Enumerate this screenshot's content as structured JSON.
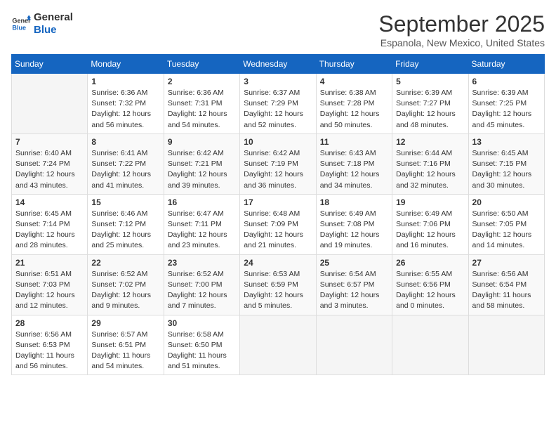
{
  "logo": {
    "line1": "General",
    "line2": "Blue"
  },
  "title": "September 2025",
  "location": "Espanola, New Mexico, United States",
  "days_header": [
    "Sunday",
    "Monday",
    "Tuesday",
    "Wednesday",
    "Thursday",
    "Friday",
    "Saturday"
  ],
  "weeks": [
    [
      {
        "day": "",
        "info": ""
      },
      {
        "day": "1",
        "info": "Sunrise: 6:36 AM\nSunset: 7:32 PM\nDaylight: 12 hours\nand 56 minutes."
      },
      {
        "day": "2",
        "info": "Sunrise: 6:36 AM\nSunset: 7:31 PM\nDaylight: 12 hours\nand 54 minutes."
      },
      {
        "day": "3",
        "info": "Sunrise: 6:37 AM\nSunset: 7:29 PM\nDaylight: 12 hours\nand 52 minutes."
      },
      {
        "day": "4",
        "info": "Sunrise: 6:38 AM\nSunset: 7:28 PM\nDaylight: 12 hours\nand 50 minutes."
      },
      {
        "day": "5",
        "info": "Sunrise: 6:39 AM\nSunset: 7:27 PM\nDaylight: 12 hours\nand 48 minutes."
      },
      {
        "day": "6",
        "info": "Sunrise: 6:39 AM\nSunset: 7:25 PM\nDaylight: 12 hours\nand 45 minutes."
      }
    ],
    [
      {
        "day": "7",
        "info": "Sunrise: 6:40 AM\nSunset: 7:24 PM\nDaylight: 12 hours\nand 43 minutes."
      },
      {
        "day": "8",
        "info": "Sunrise: 6:41 AM\nSunset: 7:22 PM\nDaylight: 12 hours\nand 41 minutes."
      },
      {
        "day": "9",
        "info": "Sunrise: 6:42 AM\nSunset: 7:21 PM\nDaylight: 12 hours\nand 39 minutes."
      },
      {
        "day": "10",
        "info": "Sunrise: 6:42 AM\nSunset: 7:19 PM\nDaylight: 12 hours\nand 36 minutes."
      },
      {
        "day": "11",
        "info": "Sunrise: 6:43 AM\nSunset: 7:18 PM\nDaylight: 12 hours\nand 34 minutes."
      },
      {
        "day": "12",
        "info": "Sunrise: 6:44 AM\nSunset: 7:16 PM\nDaylight: 12 hours\nand 32 minutes."
      },
      {
        "day": "13",
        "info": "Sunrise: 6:45 AM\nSunset: 7:15 PM\nDaylight: 12 hours\nand 30 minutes."
      }
    ],
    [
      {
        "day": "14",
        "info": "Sunrise: 6:45 AM\nSunset: 7:14 PM\nDaylight: 12 hours\nand 28 minutes."
      },
      {
        "day": "15",
        "info": "Sunrise: 6:46 AM\nSunset: 7:12 PM\nDaylight: 12 hours\nand 25 minutes."
      },
      {
        "day": "16",
        "info": "Sunrise: 6:47 AM\nSunset: 7:11 PM\nDaylight: 12 hours\nand 23 minutes."
      },
      {
        "day": "17",
        "info": "Sunrise: 6:48 AM\nSunset: 7:09 PM\nDaylight: 12 hours\nand 21 minutes."
      },
      {
        "day": "18",
        "info": "Sunrise: 6:49 AM\nSunset: 7:08 PM\nDaylight: 12 hours\nand 19 minutes."
      },
      {
        "day": "19",
        "info": "Sunrise: 6:49 AM\nSunset: 7:06 PM\nDaylight: 12 hours\nand 16 minutes."
      },
      {
        "day": "20",
        "info": "Sunrise: 6:50 AM\nSunset: 7:05 PM\nDaylight: 12 hours\nand 14 minutes."
      }
    ],
    [
      {
        "day": "21",
        "info": "Sunrise: 6:51 AM\nSunset: 7:03 PM\nDaylight: 12 hours\nand 12 minutes."
      },
      {
        "day": "22",
        "info": "Sunrise: 6:52 AM\nSunset: 7:02 PM\nDaylight: 12 hours\nand 9 minutes."
      },
      {
        "day": "23",
        "info": "Sunrise: 6:52 AM\nSunset: 7:00 PM\nDaylight: 12 hours\nand 7 minutes."
      },
      {
        "day": "24",
        "info": "Sunrise: 6:53 AM\nSunset: 6:59 PM\nDaylight: 12 hours\nand 5 minutes."
      },
      {
        "day": "25",
        "info": "Sunrise: 6:54 AM\nSunset: 6:57 PM\nDaylight: 12 hours\nand 3 minutes."
      },
      {
        "day": "26",
        "info": "Sunrise: 6:55 AM\nSunset: 6:56 PM\nDaylight: 12 hours\nand 0 minutes."
      },
      {
        "day": "27",
        "info": "Sunrise: 6:56 AM\nSunset: 6:54 PM\nDaylight: 11 hours\nand 58 minutes."
      }
    ],
    [
      {
        "day": "28",
        "info": "Sunrise: 6:56 AM\nSunset: 6:53 PM\nDaylight: 11 hours\nand 56 minutes."
      },
      {
        "day": "29",
        "info": "Sunrise: 6:57 AM\nSunset: 6:51 PM\nDaylight: 11 hours\nand 54 minutes."
      },
      {
        "day": "30",
        "info": "Sunrise: 6:58 AM\nSunset: 6:50 PM\nDaylight: 11 hours\nand 51 minutes."
      },
      {
        "day": "",
        "info": ""
      },
      {
        "day": "",
        "info": ""
      },
      {
        "day": "",
        "info": ""
      },
      {
        "day": "",
        "info": ""
      }
    ]
  ]
}
